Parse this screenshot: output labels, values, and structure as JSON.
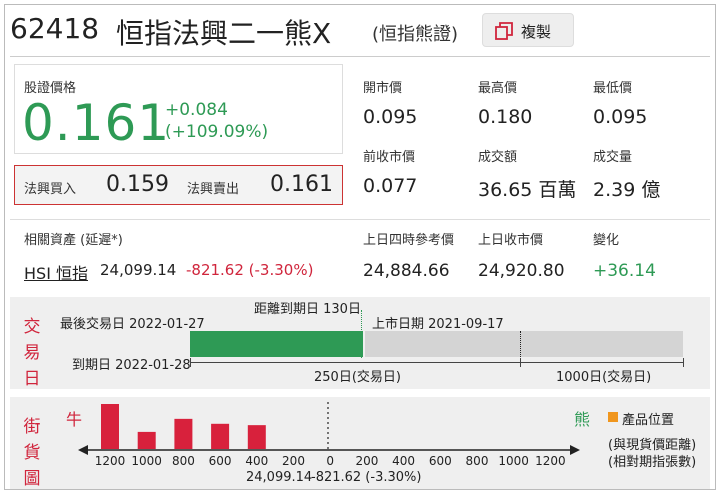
{
  "header": {
    "code": "62418",
    "name": "恒指法興二一熊X",
    "type": "(恒指熊證)",
    "copy_label": "複製"
  },
  "quote": {
    "price_label": "股證價格",
    "price": "0.161",
    "change": "+0.084",
    "change_pct": "(+109.09%)",
    "bid_label": "法興買入",
    "bid": "0.159",
    "ask_label": "法興賣出",
    "ask": "0.161"
  },
  "stats": {
    "open_label": "開市價",
    "open": "0.095",
    "high_label": "最高價",
    "high": "0.180",
    "low_label": "最低價",
    "low": "0.095",
    "prev_close_label": "前收市價",
    "prev_close": "0.077",
    "turnover_label": "成交額",
    "turnover": "36.65 百萬",
    "volume_label": "成交量",
    "volume": "2.39 億"
  },
  "underlying": {
    "label": "相關資產 (延遲*)",
    "name": "HSI 恒指",
    "price": "24,099.14",
    "change": "-821.62 (-3.30%)",
    "ref_label": "上日四時參考價",
    "ref": "24,884.66",
    "close_label": "上日收市價",
    "close": "24,920.80",
    "diff_label": "變化",
    "diff": "+36.14"
  },
  "timeline": {
    "side_label": [
      "交",
      "易",
      "日"
    ],
    "last_trade": "最後交易日 2022-01-27",
    "days_left": "距離到期日 130日",
    "listing": "上市日期 2021-09-17",
    "expiry": "到期日 2022-01-28",
    "scale_250": "250日(交易日)",
    "scale_1000": "1000日(交易日)",
    "elapsed_fraction": 0.35
  },
  "street": {
    "side_label": [
      "街",
      "貨",
      "圖"
    ],
    "bull_label": "牛",
    "bear_label": "熊",
    "legend_label": "產品位置",
    "note1": "(與現貨價距離)",
    "note2": "(相對期指張數)",
    "ticks": [
      "1200",
      "1000",
      "800",
      "600",
      "400",
      "200",
      "0",
      "200",
      "400",
      "600",
      "800",
      "1000",
      "1200"
    ],
    "center": "24,099.14",
    "center_change": "-821.62 (-3.30%)",
    "bars": [
      {
        "at": "1200",
        "value": 1.0
      },
      {
        "at": "1000",
        "value": 0.38
      },
      {
        "at": "800",
        "value": 0.67
      },
      {
        "at": "600",
        "value": 0.56
      },
      {
        "at": "400",
        "value": 0.53
      }
    ],
    "colors": {
      "bar": "#d8213c",
      "legend": "#f0961e"
    }
  }
}
